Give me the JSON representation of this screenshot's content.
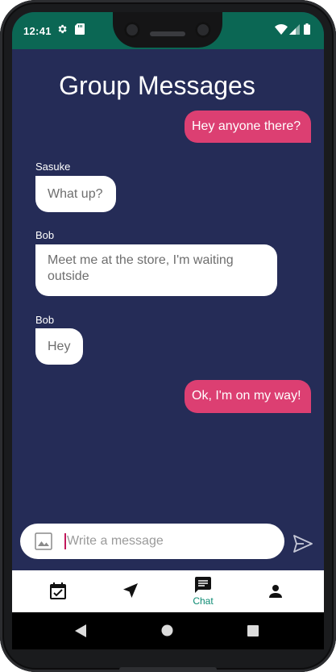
{
  "status_bar": {
    "time": "12:41",
    "icons": [
      "gear-icon",
      "sd-card-icon",
      "wifi-icon",
      "cellular-signal-icon",
      "battery-icon"
    ]
  },
  "page": {
    "title": "Group Messages"
  },
  "messages": [
    {
      "direction": "outgoing",
      "sender": "",
      "text": "Hey anyone there?"
    },
    {
      "direction": "incoming",
      "sender": "Sasuke",
      "text": "What up?"
    },
    {
      "direction": "incoming",
      "sender": "Bob",
      "text": "Meet me at the store, I'm waiting outside"
    },
    {
      "direction": "incoming",
      "sender": "Bob",
      "text": "Hey"
    },
    {
      "direction": "outgoing",
      "sender": "",
      "text": "Ok, I'm on my way!"
    }
  ],
  "composer": {
    "placeholder": "Write a message",
    "value": ""
  },
  "bottom_nav": {
    "items": [
      {
        "icon": "calendar-check-icon",
        "label": ""
      },
      {
        "icon": "navigation-arrow-icon",
        "label": ""
      },
      {
        "icon": "chat-icon",
        "label": "Chat",
        "active": true
      },
      {
        "icon": "person-icon",
        "label": ""
      }
    ]
  },
  "system_nav": {
    "buttons": [
      "back-icon",
      "home-icon",
      "recents-icon"
    ]
  },
  "colors": {
    "status_bar": "#0b6754",
    "background": "#252c57",
    "outgoing_bubble": "#dc3f72",
    "incoming_bubble": "#ffffff",
    "accent": "#0b8a72"
  }
}
